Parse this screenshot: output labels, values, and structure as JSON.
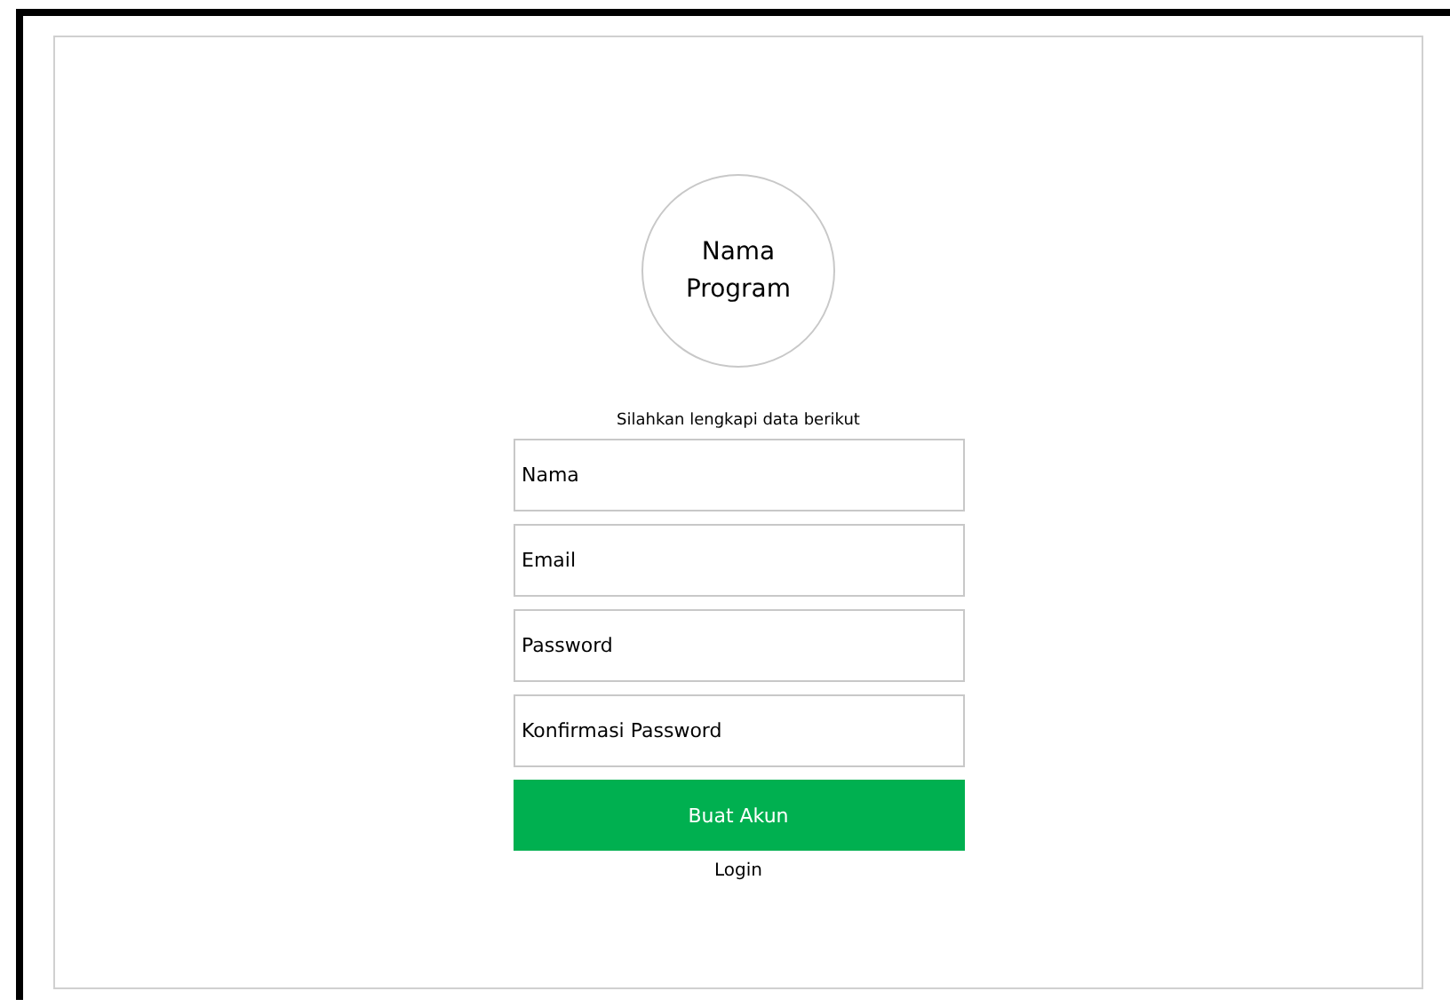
{
  "logo": {
    "text": "Nama Program"
  },
  "subtitle": "Silahkan lengkapi data berikut",
  "fields": [
    {
      "placeholder": "Nama"
    },
    {
      "placeholder": "Email"
    },
    {
      "placeholder": "Password"
    },
    {
      "placeholder": "Konfirmasi Password"
    }
  ],
  "submit_button": "Buat Akun",
  "login_link": "Login"
}
